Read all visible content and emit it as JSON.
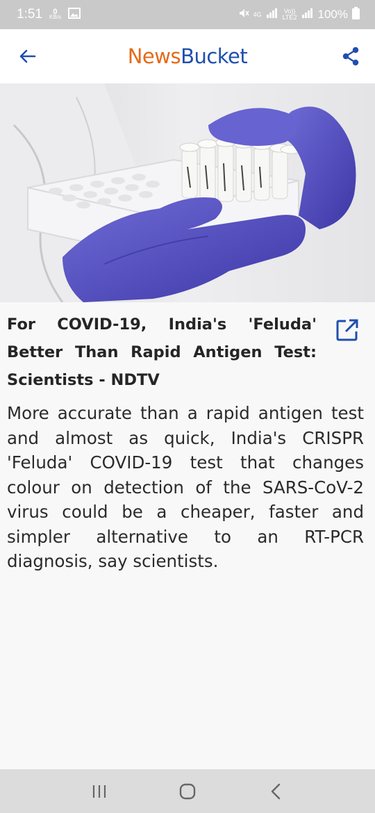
{
  "status_bar": {
    "time": "1:51",
    "data_rate_value": "0",
    "data_rate_unit": "KB/s",
    "network_label": "4G",
    "volte_label": "Vo))",
    "lte_label": "LTE2",
    "battery": "100%",
    "icons": [
      "gallery-icon",
      "mute-icon",
      "signal-icon",
      "battery-icon"
    ]
  },
  "app_bar": {
    "logo_part1": "News",
    "logo_part2": "Bucket",
    "logo_colors": {
      "news": "#e36a19",
      "bucket": "#1f4fae"
    },
    "accent": "#1f4fae",
    "icons": [
      "back-arrow-icon",
      "share-icon"
    ]
  },
  "article": {
    "image_alt_icon": "lab-test-tubes-image",
    "headline": "For COVID-19, India's 'Feluda' Better Than Rapid Antigen Test: Scientists - NDTV",
    "summary": "More accurate than a rapid antigen test and almost as quick, India's CRISPR 'Feluda' COVID-19 test that changes colour on detection of the SARS-CoV-2 virus could be a cheaper, faster and simpler alternative to an RT-PCR diagnosis, say scientists.",
    "open_icon": "open-in-new-icon"
  },
  "nav_bar": {
    "icons": [
      "recent-apps-icon",
      "home-icon",
      "back-icon"
    ]
  }
}
